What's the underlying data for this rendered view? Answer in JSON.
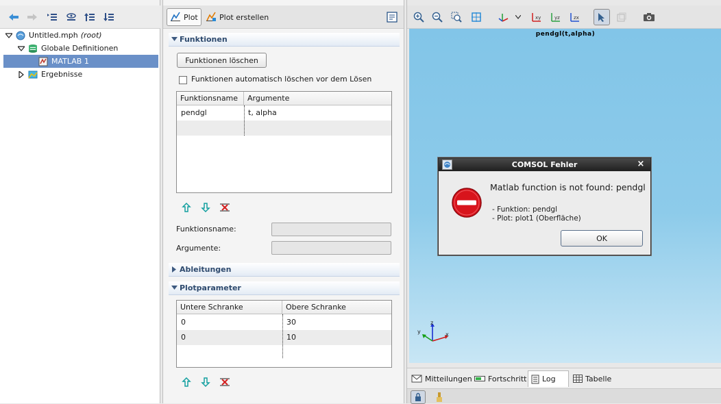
{
  "tree": {
    "root_label": "Untitled.mph",
    "root_suffix": "(root)",
    "global_defs": "Globale Definitionen",
    "matlab": "MATLAB 1",
    "results": "Ergebnisse"
  },
  "mid_toolbar": {
    "plot_label": "Plot",
    "create_plot_label": "Plot erstellen"
  },
  "functions_section": {
    "title": "Funktionen",
    "clear_button": "Funktionen löschen",
    "auto_clear_label": "Funktionen automatisch löschen vor dem Lösen",
    "auto_clear_checked": false,
    "columns": [
      "Funktionsname",
      "Argumente"
    ],
    "rows": [
      {
        "name": "pendgl",
        "args": "t, alpha"
      },
      {
        "name": "",
        "args": ""
      }
    ],
    "name_field_label": "Funktionsname:",
    "args_field_label": "Argumente:",
    "name_field_value": "",
    "args_field_value": ""
  },
  "derivatives_section": {
    "title": "Ableitungen"
  },
  "plot_params_section": {
    "title": "Plotparameter",
    "columns": [
      "Untere Schranke",
      "Obere Schranke"
    ],
    "rows": [
      {
        "lower": "0",
        "upper": "30"
      },
      {
        "lower": "0",
        "upper": "10"
      }
    ]
  },
  "graphics": {
    "plot_title": "pendgl(t,alpha)",
    "axis_x": "x",
    "axis_y": "y",
    "axis_z": "z"
  },
  "bottom_tabs": [
    {
      "label": "Mitteilungen"
    },
    {
      "label": "Fortschritt"
    },
    {
      "label": "Log"
    },
    {
      "label": "Tabelle"
    }
  ],
  "dialog": {
    "title": "COMSOL Fehler",
    "close_glyph": "×",
    "message": "Matlab function is not found: pendgl",
    "detail_function": "- Funktion: pendgl",
    "detail_plot": "- Plot: plot1 (Oberfläche)",
    "ok_label": "OK"
  },
  "colors": {
    "selection": "#6a90c8",
    "graphics_bg": "#82c5e8",
    "error_red": "#d8141c"
  }
}
